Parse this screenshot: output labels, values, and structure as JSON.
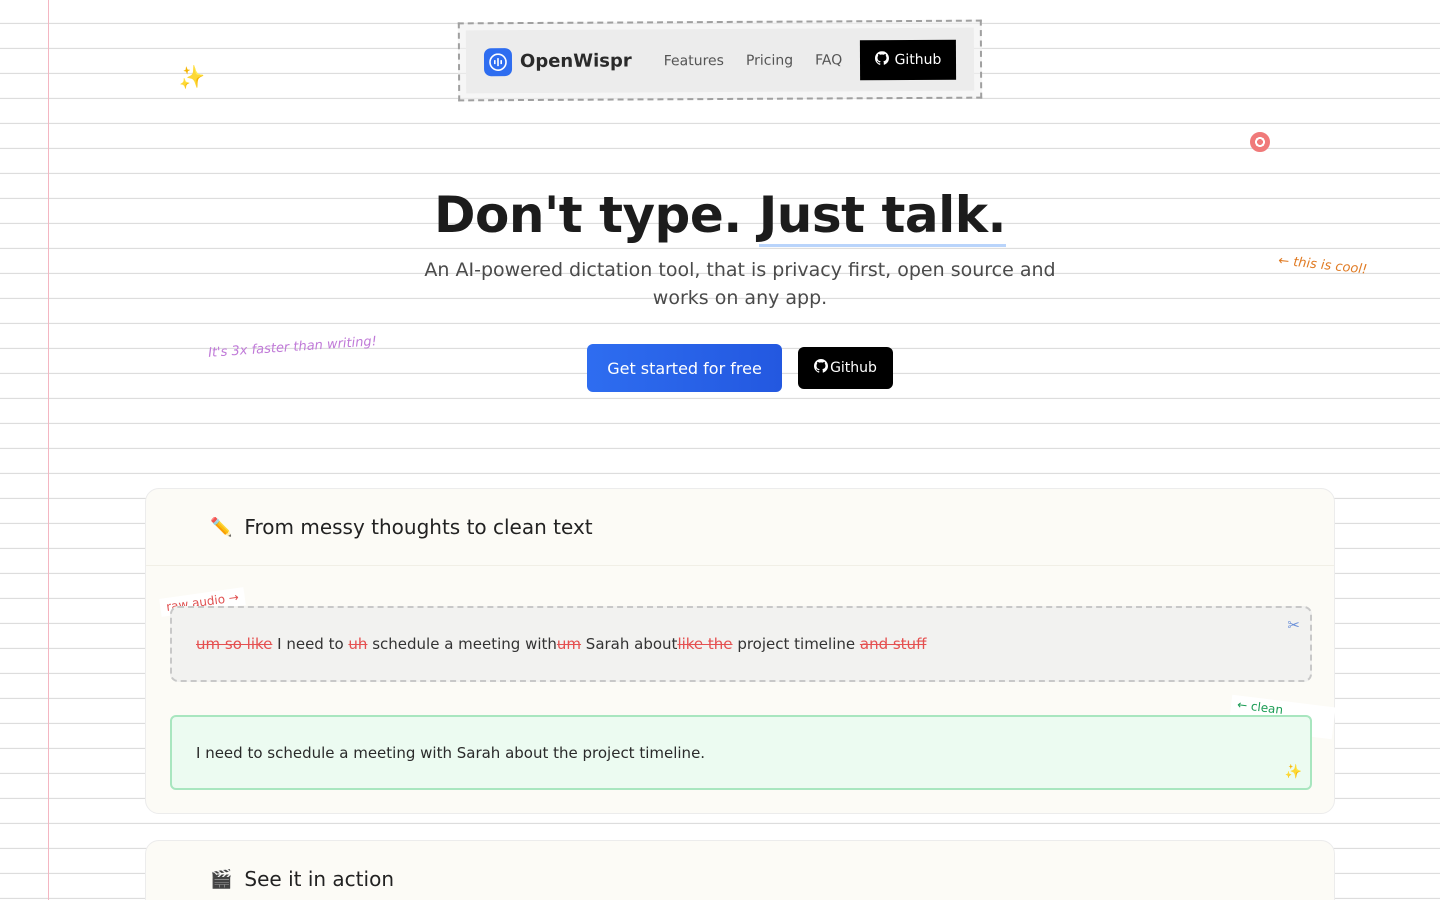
{
  "nav": {
    "logo_text": "OpenWispr",
    "links": [
      "Features",
      "Pricing",
      "FAQ"
    ],
    "github_label": "Github"
  },
  "hero": {
    "title_part1": "Don't type.",
    "title_part2": "Just talk.",
    "subtitle": "An AI-powered dictation tool, that is privacy first, open source and works on any app.",
    "cta_primary": "Get started for free",
    "cta_github": "Github"
  },
  "notes": {
    "cool": "← this is cool!",
    "faster": "It's 3x faster than writing!"
  },
  "demo_card": {
    "emoji": "✏️",
    "title": "From messy thoughts to clean text",
    "raw_tag": "raw audio →",
    "raw_segments": [
      {
        "text": "um so like",
        "struck": true
      },
      {
        "text": " I need to ",
        "struck": false
      },
      {
        "text": "uh",
        "struck": true
      },
      {
        "text": " schedule a meeting with",
        "struck": false
      },
      {
        "text": "um",
        "struck": true
      },
      {
        "text": " Sarah about",
        "struck": false
      },
      {
        "text": "like the",
        "struck": true
      },
      {
        "text": " project timeline ",
        "struck": false
      },
      {
        "text": "and stuff",
        "struck": true
      }
    ],
    "clean_tag": "← clean output!",
    "clean_text": "I need to schedule a meeting with Sarah about the project timeline."
  },
  "action_card": {
    "emoji": "🎬",
    "title": "See it in action"
  },
  "colors": {
    "accent": "#2e6df0",
    "strike": "#e55050",
    "clean_border": "#a8e6bf",
    "clean_bg": "#ecfbf1"
  }
}
